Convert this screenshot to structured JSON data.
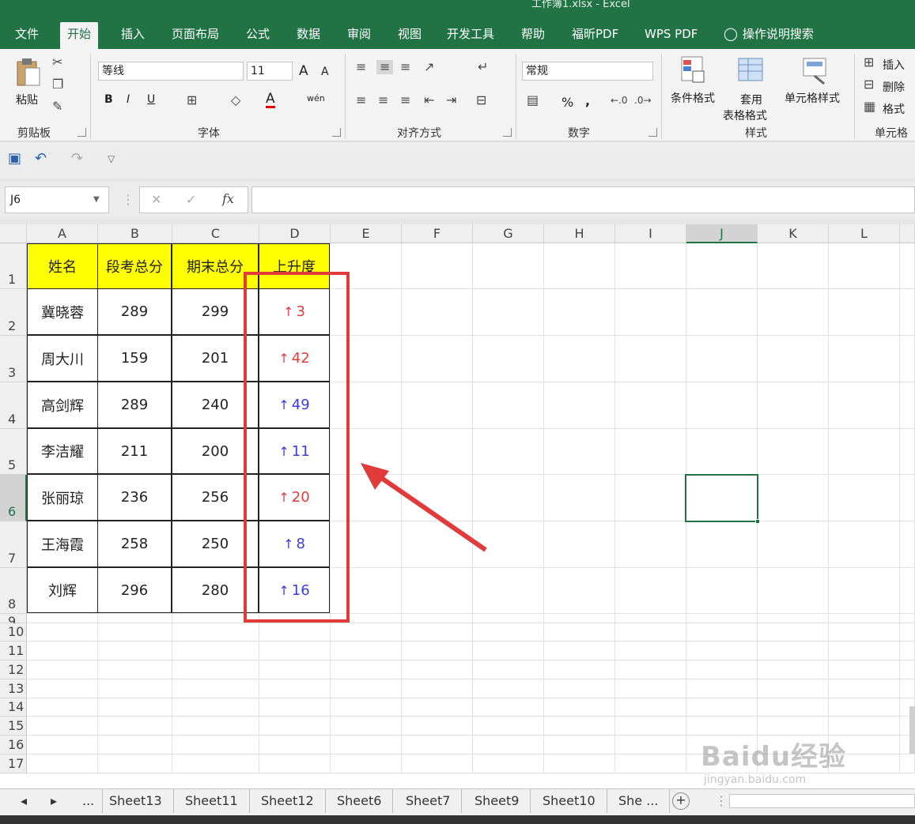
{
  "window": {
    "title": "工作簿1.xlsx  -  Excel"
  },
  "tabs": [
    "文件",
    "开始",
    "插入",
    "页面布局",
    "公式",
    "数据",
    "审阅",
    "视图",
    "开发工具",
    "帮助",
    "福昕PDF",
    "WPS PDF",
    "操作说明搜索"
  ],
  "active_tab": "开始",
  "ribbon": {
    "clipboard": {
      "paste": "粘贴",
      "label": "剪贴板"
    },
    "font": {
      "name": "等线",
      "size": "11",
      "bold": "B",
      "italic": "I",
      "underline": "U",
      "grow": "A",
      "shrink": "A",
      "color": "A",
      "phonetic": "wén",
      "label": "字体"
    },
    "alignment": {
      "label": "对齐方式"
    },
    "number": {
      "format": "常规",
      "percent": "%",
      "comma": ",",
      "label": "数字"
    },
    "styles": {
      "conditional": "条件格式",
      "table_line1": "套用",
      "table_line2": "表格格式",
      "cell_styles": "单元格样式",
      "label": "样式"
    },
    "cells": {
      "insert": "插入",
      "delete": "删除",
      "format": "格式",
      "label": "单元格"
    }
  },
  "formula_bar": {
    "name_box": "J6",
    "fx": "fx",
    "value": ""
  },
  "columns": [
    "A",
    "B",
    "C",
    "D",
    "E",
    "F",
    "G",
    "H",
    "I",
    "J",
    "K",
    "L"
  ],
  "selected_column": "J",
  "selected_row": "6",
  "rows": [
    "1",
    "2",
    "3",
    "4",
    "5",
    "6",
    "7",
    "8",
    "9",
    "10",
    "11",
    "12",
    "13",
    "14",
    "15",
    "16",
    "17"
  ],
  "table": {
    "headers": [
      "姓名",
      "段考总分",
      "期末总分",
      "上升度"
    ],
    "rows": [
      {
        "name": "冀晓蓉",
        "b": "289",
        "c": "299",
        "arrow": "↑",
        "d": "3",
        "color": "red"
      },
      {
        "name": "周大川",
        "b": "159",
        "c": "201",
        "arrow": "↑",
        "d": "42",
        "color": "red"
      },
      {
        "name": "高剑辉",
        "b": "289",
        "c": "240",
        "arrow": "↑",
        "d": "49",
        "color": "blue"
      },
      {
        "name": "李洁耀",
        "b": "211",
        "c": "200",
        "arrow": "↑",
        "d": "11",
        "color": "blue"
      },
      {
        "name": "张丽琼",
        "b": "236",
        "c": "256",
        "arrow": "↑",
        "d": "20",
        "color": "red"
      },
      {
        "name": "王海霞",
        "b": "258",
        "c": "250",
        "arrow": "↑",
        "d": "8",
        "color": "blue"
      },
      {
        "name": "刘辉",
        "b": "296",
        "c": "280",
        "arrow": "↑",
        "d": "16",
        "color": "blue"
      }
    ]
  },
  "sheet_tabs": [
    "Sheet13",
    "Sheet11",
    "Sheet12",
    "Sheet6",
    "Sheet7",
    "Sheet9",
    "Sheet10",
    "She ..."
  ],
  "sheet_nav": {
    "prev": "◂",
    "next": "▸",
    "more": "...",
    "add": "+"
  },
  "watermark": {
    "text": "Baidu经验",
    "sub": "jingyan.baidu.com"
  },
  "colors": {
    "excel_green": "#217346",
    "header_fill": "#ffff00",
    "highlight_red": "#e03a3a",
    "value_red": "#e03c3c",
    "value_blue": "#3c3cd8"
  }
}
